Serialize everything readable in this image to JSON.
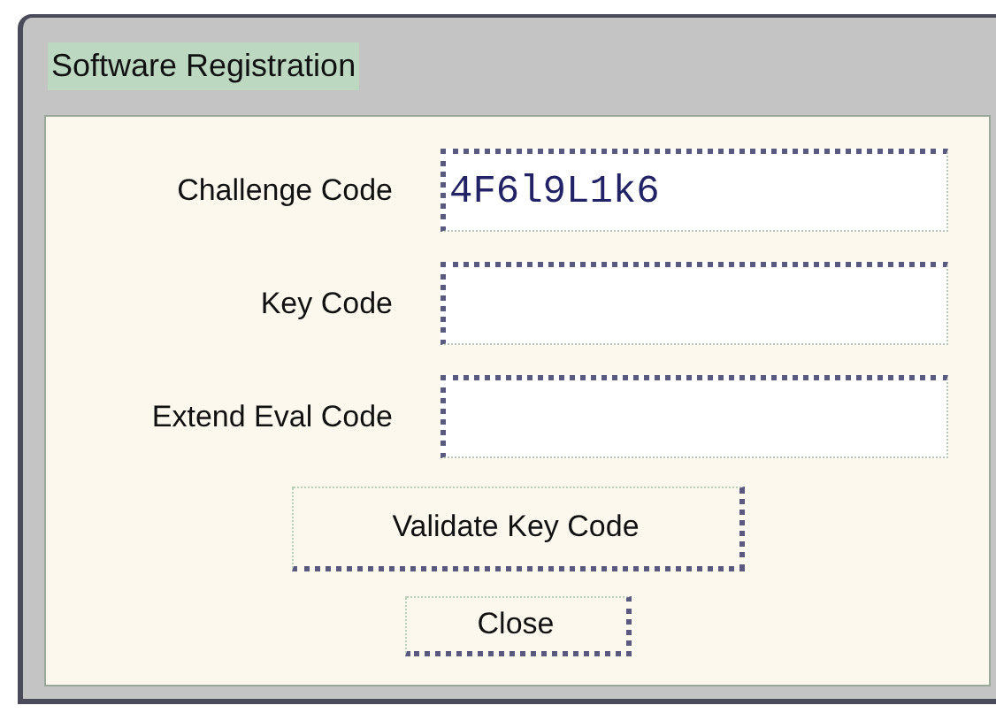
{
  "window": {
    "title": "Software Registration"
  },
  "fields": [
    {
      "label": "Challenge Code",
      "value": "4F6l9L1k6"
    },
    {
      "label": "Key Code"
    },
    {
      "label": "Extend Eval Code"
    }
  ],
  "buttons": [
    {
      "kind": "wide",
      "label": "Validate Key Code"
    },
    {
      "kind": "narrow",
      "label": "Close"
    }
  ]
}
